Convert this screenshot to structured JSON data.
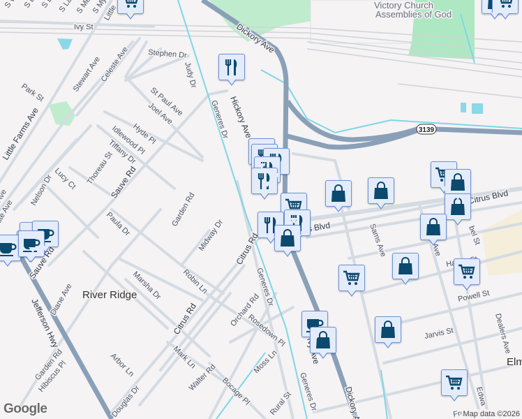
{
  "map": {
    "place_labels": {
      "river_ridge": "River Ridge",
      "elmwood_partial": "Elm",
      "church": [
        "Victory Church",
        "Assemblies of God"
      ]
    },
    "highway_shield": "3139",
    "streets": {
      "ivy": "Ivy St",
      "little_farms": "Little Farms Ave",
      "little_top": "Little",
      "stephen": "Stephen Dr",
      "stewart": "Stewart Ave",
      "celeste": "Celeste Ave",
      "park": "Park St",
      "judy": "Judy Dr",
      "st_paul": "St Paul Ave",
      "joel": "Joel Ave",
      "hyde": "Hyde Pl",
      "idlewood": "Idlewood Pl",
      "tiffany": "Tiffany Dr",
      "thoreau": "Thoreau St",
      "sauve_top": "Sauve Rd",
      "lucy": "Lucy Ct",
      "nelson": "Nelson Dr",
      "generes_top": "Generes Dr",
      "hickory": "Hickory Ave",
      "dickory_top": "Dickory Ave",
      "garden_top": "Garden Rd",
      "midway": "Midway Dr",
      "paula": "Paula Dr",
      "sauve_bottom": "Sauve Rd",
      "marsha": "Marsha Dr",
      "robin": "Robin Ln",
      "citrus_rd_top": "Citrus Rd",
      "citrus_rd": "Citrus Rd",
      "diane": "Diane Ave",
      "jefferson": "Jefferson Hwy",
      "orchard": "Orchard Rd",
      "rosedown": "Rosedown Pl",
      "mark": "Mark Ln",
      "arbor": "Arbor Ln",
      "garden_bottom": "Garden Rd",
      "hibiscus": "Hibiscus Pl",
      "walter": "Walter Rd",
      "bocage": "Bocage Pl",
      "moss": "Moss Ln",
      "douglas": "Douglas Dr",
      "rural": "Rural St",
      "generes_mid": "Generes Dr",
      "generes_bottom": "Generes Dr",
      "ivy_ave": "Ivy Ave",
      "dickory_bottom": "Dickory Ave",
      "citrus_blvd_left": "us Blvd",
      "citrus_blvd": "Citrus Blvd",
      "sams": "Sams Ave",
      "s_ave": "s Ave",
      "abel": "bel St",
      "hayne": "Hayne St",
      "powell": "Powell St",
      "jarvis": "Jarvis St",
      "dealers": "Dealers Ave",
      "edwards": "Edwa",
      "fro": "Fro",
      "s_v": "S W",
      "s_d": "S D",
      "s_b": "S B",
      "s_la": "S La",
      "s_mea": "S Mea",
      "s_my": "S My",
      "ave_left1": "Ave",
      "ave_left2": "ste Ave"
    },
    "markers": [
      "cart",
      "fork",
      "fork",
      "fork",
      "fork",
      "fork",
      "fork",
      "cart",
      "fork",
      "fork",
      "bag",
      "bag",
      "bag",
      "cart",
      "bag",
      "bag",
      "bag",
      "bag",
      "cart",
      "cart",
      "coffee",
      "bag",
      "bag",
      "cart",
      "coffee",
      "coffee",
      "cart",
      "coffee",
      "coffee",
      "bag",
      "cart"
    ],
    "colors": {
      "marker_bg": "#e4ecfb",
      "marker_icon": "#0b4a6e",
      "highway": "#8aa0b8",
      "canal": "#7fd6e6",
      "park": "#bfeccd"
    }
  },
  "footer": {
    "logo": "Google",
    "attribution": "Map data ©2026"
  }
}
